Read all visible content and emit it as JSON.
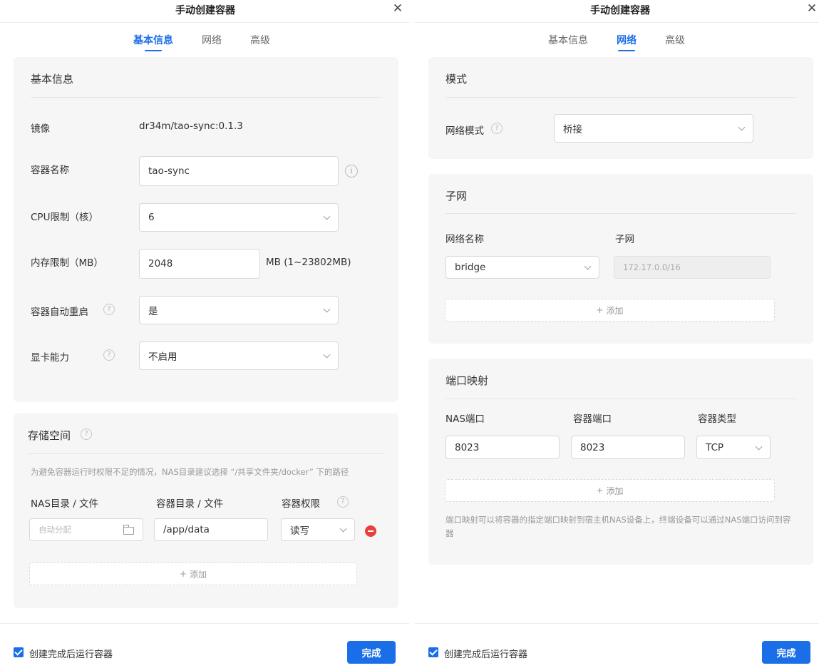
{
  "left": {
    "title": "手动创建容器",
    "close_icon": "close-icon",
    "tabs": [
      {
        "label": "基本信息",
        "active": true
      },
      {
        "label": "网络",
        "active": false
      },
      {
        "label": "高级",
        "active": false
      }
    ],
    "basic": {
      "section_title": "基本信息",
      "image_label": "镜像",
      "image_value": "dr34m/tao-sync:0.1.3",
      "name_label": "容器名称",
      "name_value": "tao-sync",
      "cpu_label": "CPU限制（核）",
      "cpu_value": "6",
      "mem_label": "内存限制（MB）",
      "mem_value": "2048",
      "mem_unit": "MB (1~23802MB)",
      "restart_label": "容器自动重启",
      "restart_value": "是",
      "gpu_label": "显卡能力",
      "gpu_value": "不启用"
    },
    "storage": {
      "section_title": "存储空间",
      "hint": "为避免容器运行时权限不足的情况，NAS目录建议选择 “/共享文件夹/docker” 下的路径",
      "col_nas": "NAS目录 / 文件",
      "col_container": "容器目录 / 文件",
      "col_perm": "容器权限",
      "rows": [
        {
          "nas_placeholder": "自动分配",
          "container_path": "/app/data",
          "permission": "读写"
        }
      ],
      "add_label": "添加"
    },
    "footer": {
      "checkbox_label": "创建完成后运行容器",
      "checked": true,
      "done_label": "完成"
    }
  },
  "right": {
    "title": "手动创建容器",
    "close_icon": "close-icon",
    "tabs": [
      {
        "label": "基本信息",
        "active": false
      },
      {
        "label": "网络",
        "active": true
      },
      {
        "label": "高级",
        "active": false
      }
    ],
    "mode": {
      "section_title": "模式",
      "network_mode_label": "网络模式",
      "network_mode_value": "桥接"
    },
    "subnet": {
      "section_title": "子网",
      "col_name": "网络名称",
      "col_subnet": "子网",
      "rows": [
        {
          "network_name": "bridge",
          "subnet": "172.17.0.0/16"
        }
      ],
      "add_label": "添加"
    },
    "ports": {
      "section_title": "端口映射",
      "col_nas": "NAS端口",
      "col_container": "容器端口",
      "col_type": "容器类型",
      "rows": [
        {
          "nas_port": "8023",
          "container_port": "8023",
          "type": "TCP"
        }
      ],
      "add_label": "添加",
      "hint": "端口映射可以将容器的指定端口映射到宿主机NAS设备上，终端设备可以通过NAS端口访问到容器"
    },
    "footer": {
      "checkbox_label": "创建完成后运行容器",
      "checked": true,
      "done_label": "完成"
    }
  },
  "colors": {
    "accent": "#1a6ee8",
    "danger": "#e8403f",
    "card_bg": "#f6f6f7"
  }
}
